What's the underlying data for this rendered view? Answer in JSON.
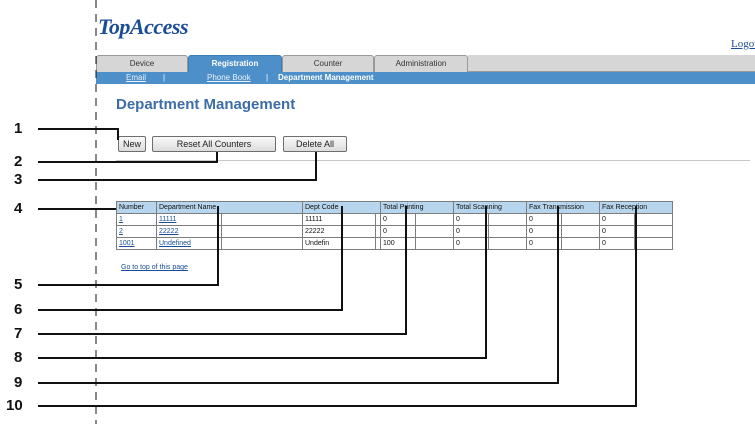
{
  "app": {
    "logo": "TopAccess",
    "logout": "Logou"
  },
  "tabs": [
    {
      "label": "Device",
      "active": false
    },
    {
      "label": "Registration",
      "active": true
    },
    {
      "label": "Counter",
      "active": false
    },
    {
      "label": "Administration",
      "active": false
    }
  ],
  "subnav": {
    "email": "Email",
    "phone_book": "Phone Book",
    "department_management": "Department Management",
    "separator": "|"
  },
  "page_title": "Department Management",
  "buttons": {
    "new": "New",
    "reset_all_counters": "Reset All Counters",
    "delete_all": "Delete All"
  },
  "table": {
    "headers": [
      "Number",
      "Department Name",
      "Dept Code",
      "Total Printing",
      "Total Scanning",
      "Fax Transmission",
      "Fax Reception"
    ],
    "rows": [
      {
        "number": "1",
        "name": "11111",
        "code": "11111",
        "printing": "0",
        "scanning": "0",
        "fax_tx": "0",
        "fax_rx": "0"
      },
      {
        "number": "2",
        "name": "22222",
        "code": "22222",
        "printing": "0",
        "scanning": "0",
        "fax_tx": "0",
        "fax_rx": "0"
      },
      {
        "number": "1001",
        "name": "Undefined",
        "code": "Undefin",
        "printing": "100",
        "scanning": "0",
        "fax_tx": "0",
        "fax_rx": "0"
      }
    ]
  },
  "top_link": "Go to top of this page",
  "callouts": [
    "1",
    "2",
    "3",
    "4",
    "5",
    "6",
    "7",
    "8",
    "9",
    "10"
  ],
  "colors": {
    "accent": "#4d8fc8",
    "title": "#3d6da8",
    "header_cell": "#b7d5ec",
    "link": "#1a4d95"
  }
}
